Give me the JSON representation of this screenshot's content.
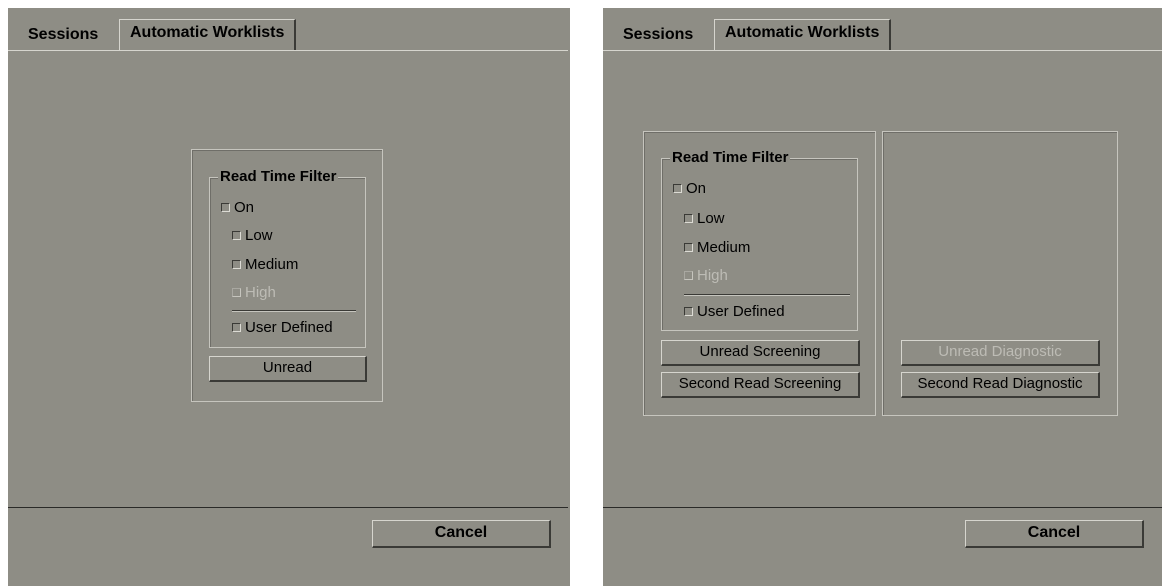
{
  "dialog_left": {
    "tabs": [
      {
        "label": "Sessions"
      },
      {
        "label": "Automatic Worklists"
      }
    ],
    "filter": {
      "legend": "Read Time Filter",
      "on": "On",
      "low": "Low",
      "medium": "Medium",
      "high": "High",
      "user_defined": "User Defined"
    },
    "unread_button": "Unread",
    "cancel_button": "Cancel"
  },
  "dialog_right": {
    "tabs": [
      {
        "label": "Sessions"
      },
      {
        "label": "Automatic Worklists"
      }
    ],
    "filter": {
      "legend": "Read Time Filter",
      "on": "On",
      "low": "Low",
      "medium": "Medium",
      "high": "High",
      "user_defined": "User Defined"
    },
    "unread_screening_button": "Unread Screening",
    "second_read_screening_button": "Second Read Screening",
    "unread_diagnostic_button": "Unread Diagnostic",
    "second_read_diagnostic_button": "Second Read Diagnostic",
    "cancel_button": "Cancel"
  },
  "colors": {
    "dialog_background": "#8e8d85",
    "disabled_text": "#bdbcb5"
  }
}
